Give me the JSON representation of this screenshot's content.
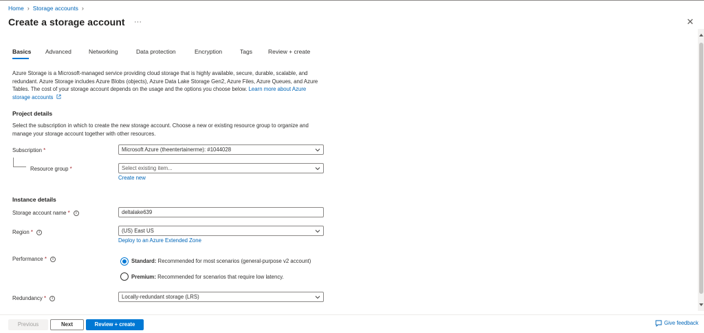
{
  "breadcrumb": {
    "home": "Home",
    "separator": "›",
    "current": "Storage accounts"
  },
  "header": {
    "title": "Create a storage account",
    "more": "···",
    "close": "✕"
  },
  "tabs": [
    {
      "label": "Basics",
      "active": true
    },
    {
      "label": "Advanced"
    },
    {
      "label": "Networking"
    },
    {
      "label": "Data protection"
    },
    {
      "label": "Encryption"
    },
    {
      "label": "Tags"
    },
    {
      "label": "Review + create"
    }
  ],
  "intro": {
    "text": "Azure Storage is a Microsoft-managed service providing cloud storage that is highly available, secure, durable, scalable, and redundant. Azure Storage includes Azure Blobs (objects), Azure Data Lake Storage Gen2, Azure Files, Azure Queues, and Azure Tables. The cost of your storage account depends on the usage and the options you choose below. ",
    "link": "Learn more about Azure storage accounts"
  },
  "project": {
    "heading": "Project details",
    "description": "Select the subscription in which to create the new storage account. Choose a new or existing resource group to organize and manage your storage account together with other resources.",
    "subscription_label": "Subscription",
    "subscription_value": "Microsoft Azure (theentertainerme): #1044028",
    "resource_group_label": "Resource group",
    "resource_group_placeholder": "Select existing item...",
    "create_new": "Create new"
  },
  "instance": {
    "heading": "Instance details",
    "name_label": "Storage account name",
    "name_value": "deltalake639",
    "region_label": "Region",
    "region_value": "(US) East US",
    "extended_zone_link": "Deploy to an Azure Extended Zone",
    "performance_label": "Performance",
    "perf_standard_title": "Standard:",
    "perf_standard_desc": " Recommended for most scenarios (general-purpose v2 account)",
    "perf_premium_title": "Premium:",
    "perf_premium_desc": " Recommended for scenarios that require low latency.",
    "redundancy_label": "Redundancy",
    "redundancy_value": "Locally-redundant storage (LRS)"
  },
  "required_mark": "*",
  "info_glyph": "i",
  "footer": {
    "previous": "Previous",
    "next": "Next",
    "review_create": "Review + create",
    "feedback": "Give feedback"
  },
  "colors": {
    "accent": "#0078d4",
    "link": "#0066b8",
    "required": "#a4262c"
  }
}
